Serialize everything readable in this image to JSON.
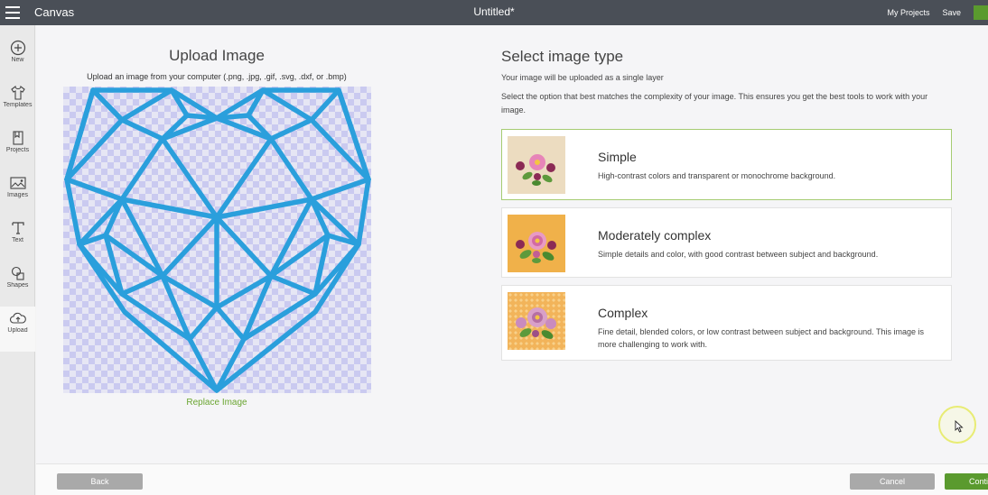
{
  "topbar": {
    "app_title": "Canvas",
    "doc_title": "Untitled*",
    "my_projects": "My Projects",
    "save": "Save",
    "menu_icon": "hamburger-menu-icon"
  },
  "sidebar": {
    "items": [
      {
        "label": "New",
        "icon": "plus-circle-icon"
      },
      {
        "label": "Templates",
        "icon": "tshirt-icon"
      },
      {
        "label": "Projects",
        "icon": "bookmark-icon"
      },
      {
        "label": "Images",
        "icon": "image-icon"
      },
      {
        "label": "Text",
        "icon": "text-t-icon"
      },
      {
        "label": "Shapes",
        "icon": "shapes-icon"
      },
      {
        "label": "Upload",
        "icon": "cloud-upload-icon"
      }
    ],
    "active": "Upload"
  },
  "upload": {
    "title": "Upload Image",
    "subtitle": "Upload an image from your computer (.png, .jpg, .gif, .svg, .dxf, or .bmp)",
    "replace_link": "Replace Image"
  },
  "select": {
    "title": "Select image type",
    "note": "Your image will be uploaded as a single layer",
    "description": "Select the option that best matches the complexity of your image. This ensures you get the best tools to work with your image.",
    "options": [
      {
        "title": "Simple",
        "description": "High-contrast colors and transparent or monochrome background.",
        "selected": true
      },
      {
        "title": "Moderately complex",
        "description": "Simple details and color, with good contrast between subject and background.",
        "selected": false
      },
      {
        "title": "Complex",
        "description": "Fine detail, blended colors, or low contrast between subject and background. This image is more challenging to work with.",
        "selected": false
      }
    ]
  },
  "footer": {
    "back": "Back",
    "cancel": "Cancel",
    "continue": "Continue"
  },
  "colors": {
    "accent_green": "#6aa531",
    "heart_stroke": "#2a9fdc",
    "topbar": "#4a4f57"
  }
}
